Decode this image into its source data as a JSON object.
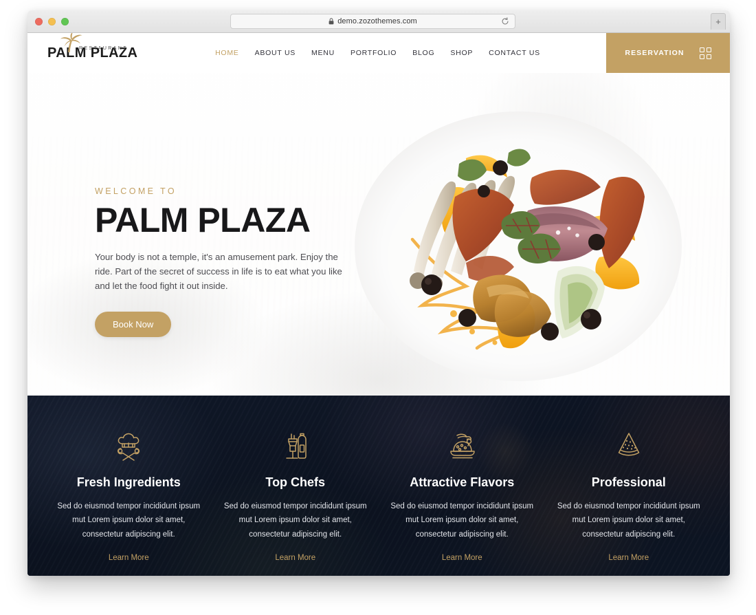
{
  "browser": {
    "url": "demo.zozothemes.com",
    "lock_icon": "lock-icon",
    "reload_icon": "reload-icon",
    "new_tab_label": "+",
    "traffic_lights": [
      "close-red",
      "minimize-yellow",
      "maximize-green"
    ]
  },
  "header": {
    "logo": {
      "icon": "palm-tree-icon",
      "sub": "RESTAURANT",
      "main": "PALM PLAZA"
    },
    "nav": [
      {
        "label": "HOME",
        "active": true
      },
      {
        "label": "ABOUT US",
        "active": false
      },
      {
        "label": "MENU",
        "active": false
      },
      {
        "label": "PORTFOLIO",
        "active": false
      },
      {
        "label": "BLOG",
        "active": false
      },
      {
        "label": "SHOP",
        "active": false
      },
      {
        "label": "CONTACT US",
        "active": false
      }
    ],
    "reservation": {
      "label": "RESERVATION",
      "icon": "grid-menu-icon"
    }
  },
  "hero": {
    "eyebrow": "WELCOME TO",
    "title": "PALM PLAZA",
    "description": "Your body is not a temple, it's an amusement park. Enjoy the ride. Part of the secret of success in life is to eat what you like and let the food fight it out inside.",
    "cta_label": "Book Now",
    "image_alt": "plated-gourmet-dish"
  },
  "features": {
    "cards": [
      {
        "icon": "chef-hat-utensils-icon",
        "title": "Fresh Ingredients",
        "description": "Sed do eiusmod tempor incididunt ipsum mut Lorem ipsum dolor sit amet, consectetur adipiscing elit.",
        "link_label": "Learn More"
      },
      {
        "icon": "jar-bottle-icon",
        "title": "Top Chefs",
        "description": "Sed do eiusmod tempor incididunt ipsum mut Lorem ipsum dolor sit amet, consectetur adipiscing elit.",
        "link_label": "Learn More"
      },
      {
        "icon": "roast-platter-icon",
        "title": "Attractive Flavors",
        "description": "Sed do eiusmod tempor incididunt ipsum mut Lorem ipsum dolor sit amet, consectetur adipiscing elit.",
        "link_label": "Learn More"
      },
      {
        "icon": "watermelon-slice-icon",
        "title": "Professional",
        "description": "Sed do eiusmod tempor incididunt ipsum mut Lorem ipsum dolor sit amet, consectetur adipiscing elit.",
        "link_label": "Learn More"
      }
    ]
  },
  "colors": {
    "gold": "#c3a164",
    "dark_navy": "#101828",
    "text_dark": "#18181a",
    "white": "#ffffff"
  }
}
